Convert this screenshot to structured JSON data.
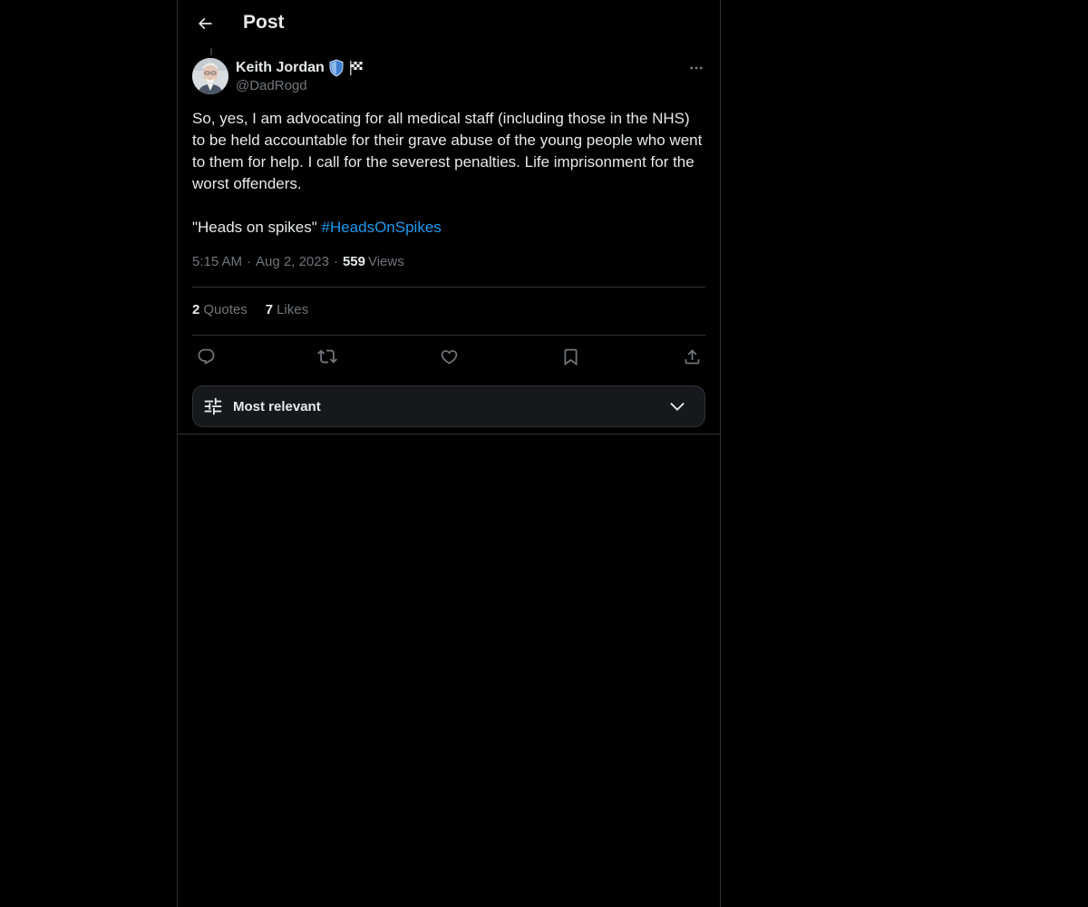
{
  "header": {
    "title": "Post"
  },
  "author": {
    "name": "Keith Jordan",
    "handle": "@DadRogd",
    "badges": [
      "shield-icon",
      "checkered-flag-icon"
    ]
  },
  "post": {
    "text": "So, yes, I am advocating for all medical staff (including those in the NHS) to be held accountable for their grave abuse of the young people who went to them for help. I call for the severest penalties. Life imprisonment for the worst offenders.\n\n\"Heads on spikes\" ",
    "hashtag": "#HeadsOnSpikes",
    "time": "5:15 AM",
    "date": "Aug 2, 2023",
    "views_count": "559",
    "views_label": "Views",
    "separator": "·"
  },
  "stats": {
    "quotes_count": "2",
    "quotes_label": "Quotes",
    "likes_count": "7",
    "likes_label": "Likes"
  },
  "actions": [
    "reply-icon",
    "repost-icon",
    "like-icon",
    "bookmark-icon",
    "share-icon"
  ],
  "sort": {
    "label": "Most relevant"
  },
  "colors": {
    "background": "#000000",
    "text": "#e7e9ea",
    "secondary": "#71767b",
    "link": "#1d9bf0",
    "border": "#2f3336"
  }
}
